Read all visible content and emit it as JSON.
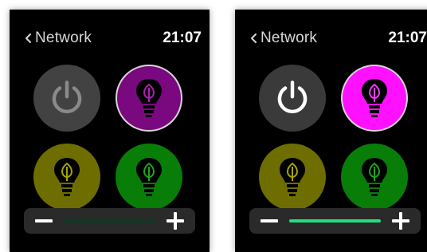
{
  "screens": {
    "left": {
      "state": "dimmed",
      "header": {
        "back_label": "Network",
        "time": "21:07"
      },
      "buttons": [
        {
          "name": "power",
          "icon": "power-icon",
          "color": "#424242",
          "active": false
        },
        {
          "name": "purple-bulb",
          "icon": "bulb-icon",
          "color": "#7a087e",
          "selected": true
        },
        {
          "name": "yellow-bulb",
          "icon": "bulb-icon",
          "color": "#6e6e00"
        },
        {
          "name": "green-bulb",
          "icon": "bulb-icon",
          "color": "#087d08"
        }
      ],
      "brightness": {
        "minus_icon": "minus-icon",
        "plus_icon": "plus-icon",
        "track_color": "#0c3a24",
        "level": 0.0
      }
    },
    "right": {
      "state": "bright",
      "header": {
        "back_label": "Network",
        "time": "21:07"
      },
      "buttons": [
        {
          "name": "power",
          "icon": "power-icon",
          "color": "#3a3a3a",
          "active": true
        },
        {
          "name": "magenta-bulb",
          "icon": "bulb-icon",
          "color": "#ff10ff",
          "selected": true
        },
        {
          "name": "yellow-bulb",
          "icon": "bulb-icon",
          "color": "#6e6e00"
        },
        {
          "name": "green-bulb",
          "icon": "bulb-icon",
          "color": "#087d08"
        }
      ],
      "brightness": {
        "minus_icon": "minus-icon",
        "plus_icon": "plus-icon",
        "track_color": "#20e07a",
        "level": 1.0
      }
    }
  }
}
